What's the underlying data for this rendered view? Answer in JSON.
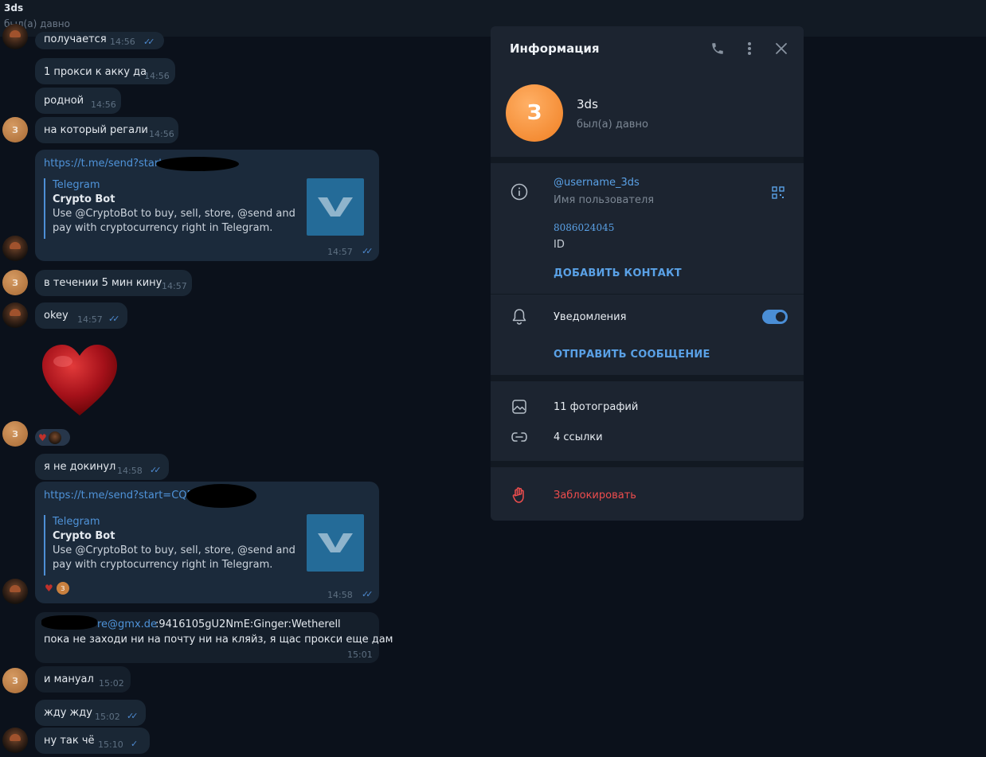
{
  "chat": {
    "title": "3ds",
    "status": "был(а) давно"
  },
  "messages": [
    {
      "text": "получается",
      "time": "14:56"
    },
    {
      "text": "1 прокси к акку да",
      "time": "14:56"
    },
    {
      "text": "родной",
      "time": "14:56"
    },
    {
      "text": "на который регали",
      "time": "14:56"
    },
    {
      "url": "https://t.me/send?start",
      "site": "Telegram",
      "name": "Crypto Bot",
      "desc": "Use @CryptoBot to buy, sell, store, @send and pay with cryptocurrency right in Telegram.",
      "time": "14:57"
    },
    {
      "text": "в течении 5 мин кину",
      "time": "14:57"
    },
    {
      "text": "okey",
      "time": "14:57"
    },
    {
      "text": "я не докинул",
      "time": "14:58"
    },
    {
      "url": "https://t.me/send?start=CQD",
      "site": "Telegram",
      "name": "Crypto Bot",
      "desc": "Use @CryptoBot to buy, sell, store, @send and pay with cryptocurrency right in Telegram.",
      "time": "14:58"
    },
    {
      "email": "re@gmx.de",
      "creds": ":9416105gU2NmE:Ginger:Wetherell",
      "text": "пока не заходи ни на почту ни на кляйз, я щас прокси еще дам",
      "time": "15:01"
    },
    {
      "text": "и мануал",
      "time": "15:02"
    },
    {
      "text": "жду жду",
      "time": "15:02"
    },
    {
      "text": "ну так чё",
      "time": "15:10"
    }
  ],
  "avatar_letter": "З",
  "reaction_letter": "З",
  "panel": {
    "title": "Информация",
    "avatar_letter": "З",
    "name": "3ds",
    "status": "был(а) давно",
    "username": "@username_3ds",
    "username_label": "Имя пользователя",
    "id_value": "8086024045",
    "id_label": "ID",
    "add_contact": "ДОБАВИТЬ КОНТАКТ",
    "notifications": "Уведомления",
    "notifications_on": true,
    "send_message": "ОТПРАВИТЬ СООБЩЕНИЕ",
    "photos": "11 фотографий",
    "links": "4 ссылки",
    "block": "Заблокировать"
  },
  "colors": {
    "accent": "#5aa1e6",
    "danger": "#ee4d4d",
    "avatar": "#f07f22"
  },
  "icons": [
    "phone-icon",
    "more-vertical-icon",
    "close-icon",
    "info-icon",
    "qr-code-icon",
    "bell-icon",
    "photo-icon",
    "link-icon",
    "block-hand-icon"
  ]
}
